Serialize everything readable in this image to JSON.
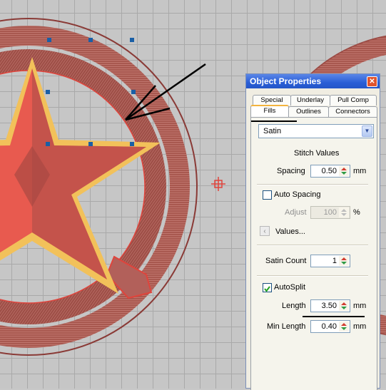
{
  "dialog": {
    "title": "Object Properties",
    "close_label": "✕",
    "tabs_row1": [
      "Special",
      "Underlay",
      "Pull Comp"
    ],
    "tabs_row2": [
      "Fills",
      "Outlines",
      "Connectors"
    ],
    "active_tab": "Fills",
    "fill_type": {
      "selected": "Satin"
    },
    "stitch_values_heading": "Stitch Values",
    "spacing": {
      "label": "Spacing",
      "value": "0.50",
      "unit": "mm"
    },
    "auto_spacing": {
      "label": "Auto Spacing",
      "checked": false
    },
    "adjust": {
      "label": "Adjust",
      "value": "100",
      "unit": "%",
      "enabled": false
    },
    "values_button": {
      "icon": "chevron-left-icon",
      "label": "Values..."
    },
    "satin_count": {
      "label": "Satin Count",
      "value": "1"
    },
    "auto_split": {
      "label": "AutoSplit",
      "checked": true
    },
    "length": {
      "label": "Length",
      "value": "3.50",
      "unit": "mm"
    },
    "min_length": {
      "label": "Min Length",
      "value": "0.40",
      "unit": "mm"
    }
  },
  "colors": {
    "titlebar": "#2a5ed6",
    "star_fill": "#e85a4f",
    "star_outline": "#f2c15a",
    "ring": "#a8584f",
    "active_tab_accent": "#f3b33e"
  }
}
